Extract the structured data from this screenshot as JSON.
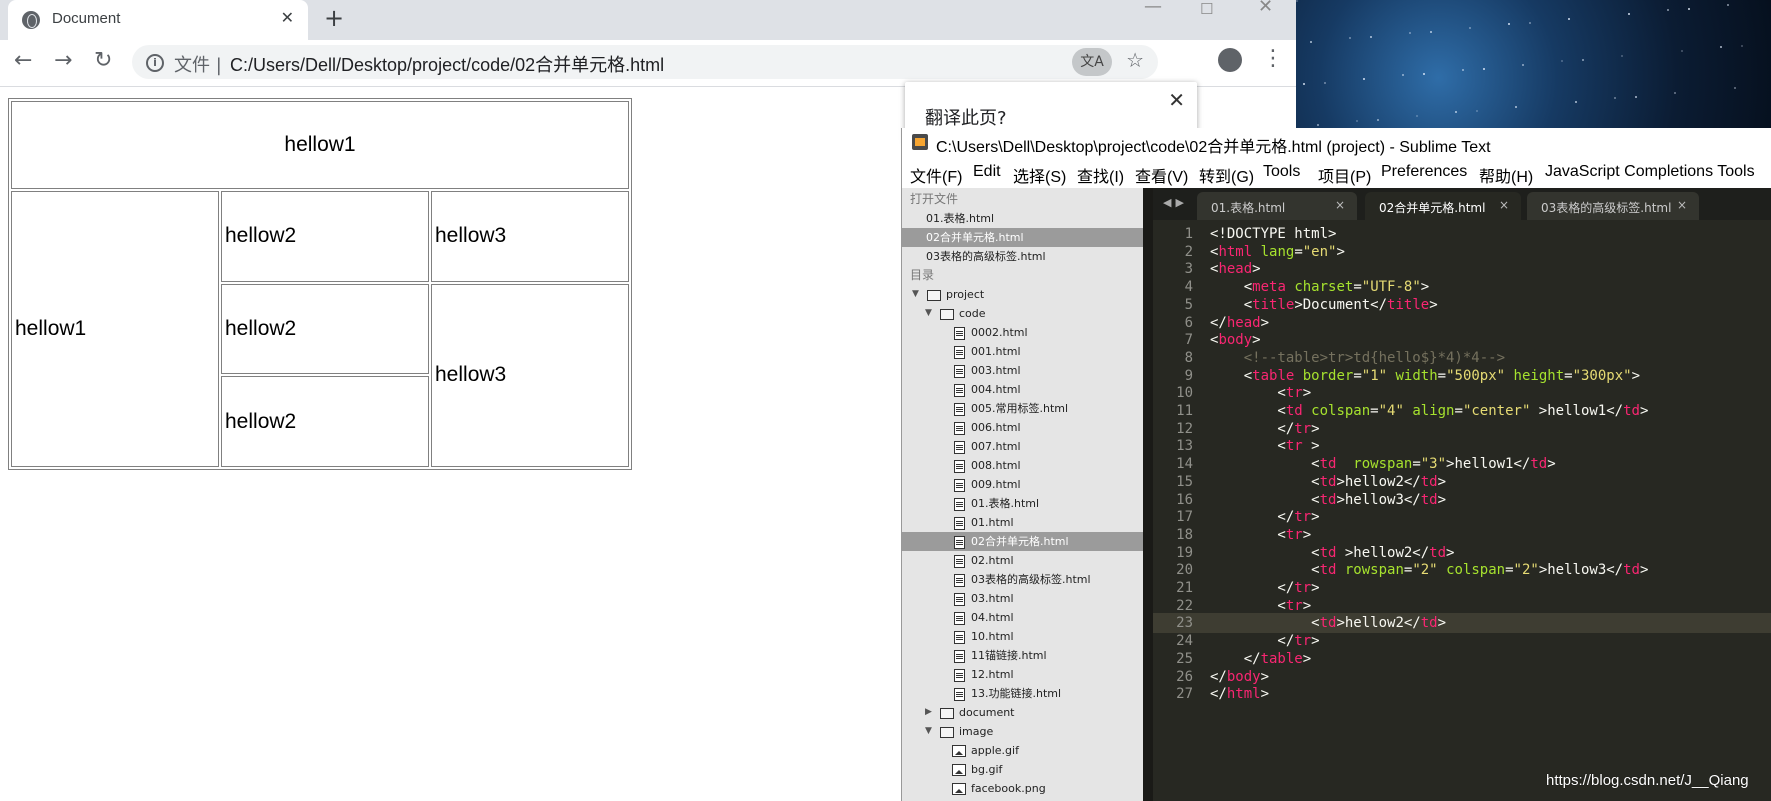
{
  "browser": {
    "tab_title": "Document",
    "tab_close": "✕",
    "new_tab": "+",
    "url_scheme_label": "文件",
    "url": "C:/Users/Dell/Desktop/project/code/02合并单元格.html",
    "translate_popup_title": "翻译此页?"
  },
  "rendered_table": {
    "row1": "hellow1",
    "row2_a": "hellow1",
    "row2_b": "hellow2",
    "row2_c": "hellow3",
    "row3_a": "hellow2",
    "row3_b": "hellow3",
    "row4_a": "hellow2"
  },
  "sublime": {
    "title": "C:\\Users\\Dell\\Desktop\\project\\code\\02合并单元格.html (project) - Sublime Text",
    "menu": [
      "文件(F)",
      "Edit",
      "选择(S)",
      "查找(I)",
      "查看(V)",
      "转到(G)",
      "Tools",
      "项目(P)",
      "Preferences",
      "帮助(H)",
      "JavaScript Completions Tools"
    ],
    "sidebar": {
      "open_files_header": "打开文件",
      "open_files": [
        "01.表格.html",
        "02合并单元格.html",
        "03表格的高级标签.html"
      ],
      "folders_header": "目录",
      "root": "project",
      "code_folder": "code",
      "code_files": [
        "0002.html",
        "001.html",
        "003.html",
        "004.html",
        "005.常用标签.html",
        "006.html",
        "007.html",
        "008.html",
        "009.html",
        "01.表格.html",
        "01.html",
        "02合并单元格.html",
        "02.html",
        "03表格的高级标签.html",
        "03.html",
        "04.html",
        "10.html",
        "11锚链接.html",
        "12.html",
        "13.功能链接.html"
      ],
      "document_folder": "document",
      "image_folder": "image",
      "image_files": [
        "apple.gif",
        "bg.gif",
        "facebook.png"
      ]
    },
    "tabs": [
      "01.表格.html",
      "02合并单元格.html",
      "03表格的高级标签.html"
    ],
    "tab_close": "×",
    "code_lines": [
      "<!DOCTYPE html>",
      "<html lang=\"en\">",
      "<head>",
      "    <meta charset=\"UTF-8\">",
      "    <title>Document</title>",
      "</head>",
      "<body>",
      "    <!--table>tr>td{hello$}*4)*4-->",
      "    <table border=\"1\" width=\"500px\" height=\"300px\">",
      "        <tr>",
      "        <td colspan=\"4\" align=\"center\" >hellow1</td>",
      "        </tr>",
      "        <tr >",
      "            <td  rowspan=\"3\">hellow1</td>",
      "            <td>hellow2</td>",
      "            <td>hellow3</td>",
      "        </tr>",
      "        <tr>",
      "            <td >hellow2</td>",
      "            <td rowspan=\"2\" colspan=\"2\">hellow3</td>",
      "        </tr>",
      "        <tr>",
      "            <td>hellow2</td>",
      "        </tr>",
      "    </table>",
      "</body>",
      "</html>"
    ],
    "current_line": 23
  },
  "watermark": "https://blog.csdn.net/J__Qiang"
}
